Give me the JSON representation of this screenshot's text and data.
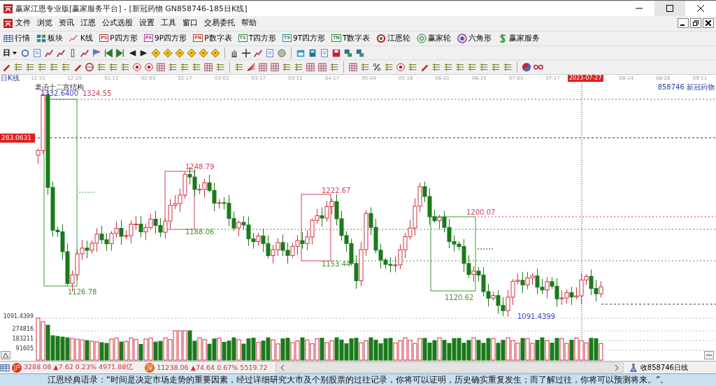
{
  "window": {
    "title": "赢家江恩专业版[赢家服务平台] - [新冠药物  GN858746-185日K线]"
  },
  "menu": [
    "文件",
    "浏览",
    "资讯",
    "江恩",
    "公式选股",
    "设置",
    "工具",
    "窗口",
    "交易委托",
    "帮助"
  ],
  "toolbar": [
    {
      "label": "行情",
      "kind": "table"
    },
    {
      "label": "板块",
      "kind": "grid"
    },
    {
      "label": "K线",
      "kind": "kline"
    },
    {
      "label": "P四方形",
      "kind": "badge",
      "badge": "PS",
      "color": "#c0392b"
    },
    {
      "label": "9P四方形",
      "kind": "badge",
      "badge": "P9",
      "color": "#b03aa0"
    },
    {
      "label": "P数字表",
      "kind": "badge",
      "badge": "PN",
      "color": "#c0392b"
    },
    {
      "label": "T四方形",
      "kind": "badge",
      "badge": "TS",
      "color": "#2e8b3a"
    },
    {
      "label": "9T四方形",
      "kind": "badge",
      "badge": "T9",
      "color": "#1f8a8a"
    },
    {
      "label": "T数字表",
      "kind": "badge",
      "badge": "TN",
      "color": "#2e8b3a"
    },
    {
      "label": "江恩轮",
      "kind": "target"
    },
    {
      "label": "赢家轮",
      "kind": "wheel"
    },
    {
      "label": "六角形",
      "kind": "hexagon"
    },
    {
      "label": "赢家服务",
      "kind": "dollar"
    }
  ],
  "period_button": "日",
  "chart": {
    "period_label": "日K线",
    "dates": [
      {
        "label": "12-15",
        "selected": false
      },
      {
        "label": "12-29",
        "selected": false
      },
      {
        "label": "01-13",
        "selected": false
      },
      {
        "label": "02-03",
        "selected": false
      },
      {
        "label": "02-17",
        "selected": false
      },
      {
        "label": "03-03",
        "selected": false
      },
      {
        "label": "03-17",
        "selected": false
      },
      {
        "label": "03-31",
        "selected": false
      },
      {
        "label": "04-17",
        "selected": false
      },
      {
        "label": "05-04",
        "selected": false
      },
      {
        "label": "05-18",
        "selected": false
      },
      {
        "label": "06-01",
        "selected": false
      },
      {
        "label": "06-15",
        "selected": false
      },
      {
        "label": "07-03",
        "selected": false
      },
      {
        "label": "07-17",
        "selected": false
      },
      {
        "label": "2023-07-27",
        "selected": true
      },
      {
        "label": "08-14",
        "selected": false
      },
      {
        "label": "08-28",
        "selected": false
      },
      {
        "label": "09-11",
        "selected": false
      }
    ],
    "study_title": "老子十二宫结构",
    "stock_label": "858746  新冠药物",
    "price_tag": "283.0631",
    "annotations": [
      {
        "text": "1332.6400",
        "kind": "mark"
      },
      {
        "text": "1324.55",
        "kind": "high"
      },
      {
        "text": "1126.78",
        "kind": "low"
      },
      {
        "text": "1248.79",
        "kind": "high"
      },
      {
        "text": "1188.06",
        "kind": "low"
      },
      {
        "text": "1222.67",
        "kind": "high"
      },
      {
        "text": "1153.44",
        "kind": "low"
      },
      {
        "text": "1200.07",
        "kind": "high"
      },
      {
        "text": "1120.62",
        "kind": "low"
      },
      {
        "text": "1091.4399",
        "kind": "mark"
      }
    ],
    "volume_labels": [
      "1091.4399",
      "274816",
      "183211",
      "91605"
    ]
  },
  "status": {
    "indices": [
      {
        "badge": "沪",
        "value": "3288.08",
        "change": "▲7.62",
        "pct": "0.23%",
        "amount": "4971.88亿"
      },
      {
        "badge": "深",
        "value": "11238.06",
        "change": "▲74.64",
        "pct": "0.67%",
        "amount": "5519.72"
      }
    ],
    "right": "收858746日线"
  },
  "ticker": "江恩经典语录：“时间是决定市场走势的重要因素，经过详细研究大市及个别股票的过往记录，你将可以证明，历史确实重复发生；而了解过往，你将可以预测将来。”。"
}
